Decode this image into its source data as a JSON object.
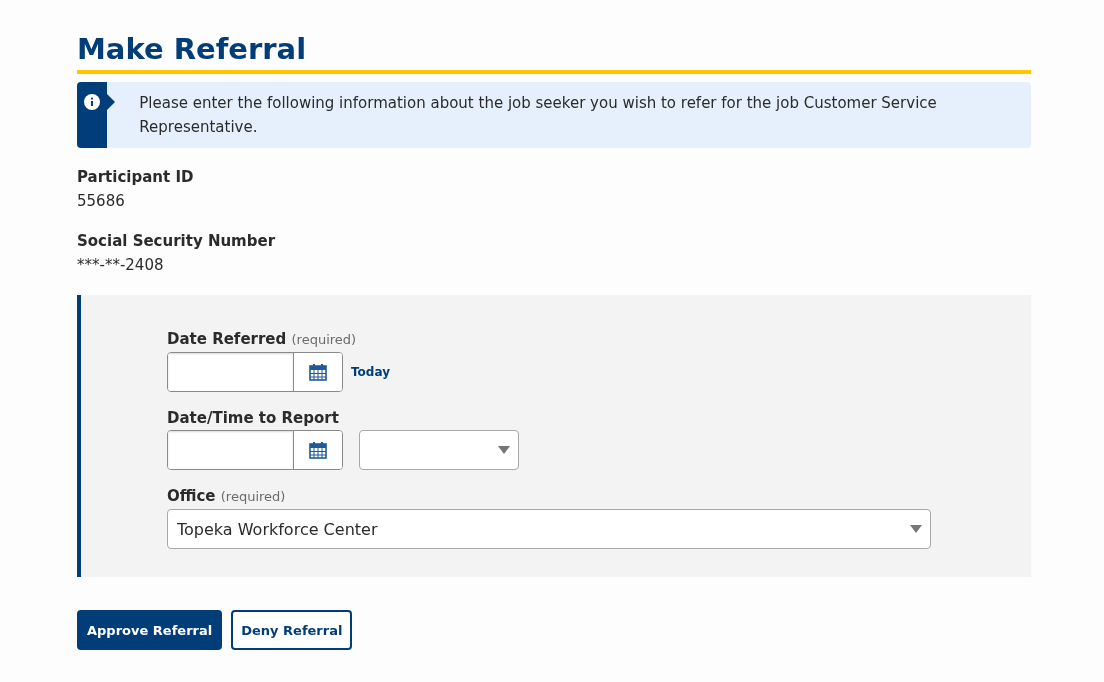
{
  "title": "Make Referral",
  "info": "Please enter the following information about the job seeker you wish to refer for the job Customer Service Representative.",
  "details": [
    {
      "label": "Participant ID",
      "value": "55686"
    },
    {
      "label": "Social Security Number",
      "value": "***-**-2408"
    }
  ],
  "form": {
    "fields": [
      {
        "kind": "date",
        "label": "Date Referred",
        "note": "(required)",
        "link": "Today"
      },
      {
        "kind": "datetime",
        "label": "Date/Time to Report"
      },
      {
        "kind": "select",
        "label": "Office",
        "note": "(required)",
        "value": "Topeka Workforce Center"
      }
    ]
  },
  "buttons": [
    {
      "label": "Approve Referral",
      "kind": "primary"
    },
    {
      "label": "Deny Referral",
      "kind": "secondary"
    }
  ]
}
